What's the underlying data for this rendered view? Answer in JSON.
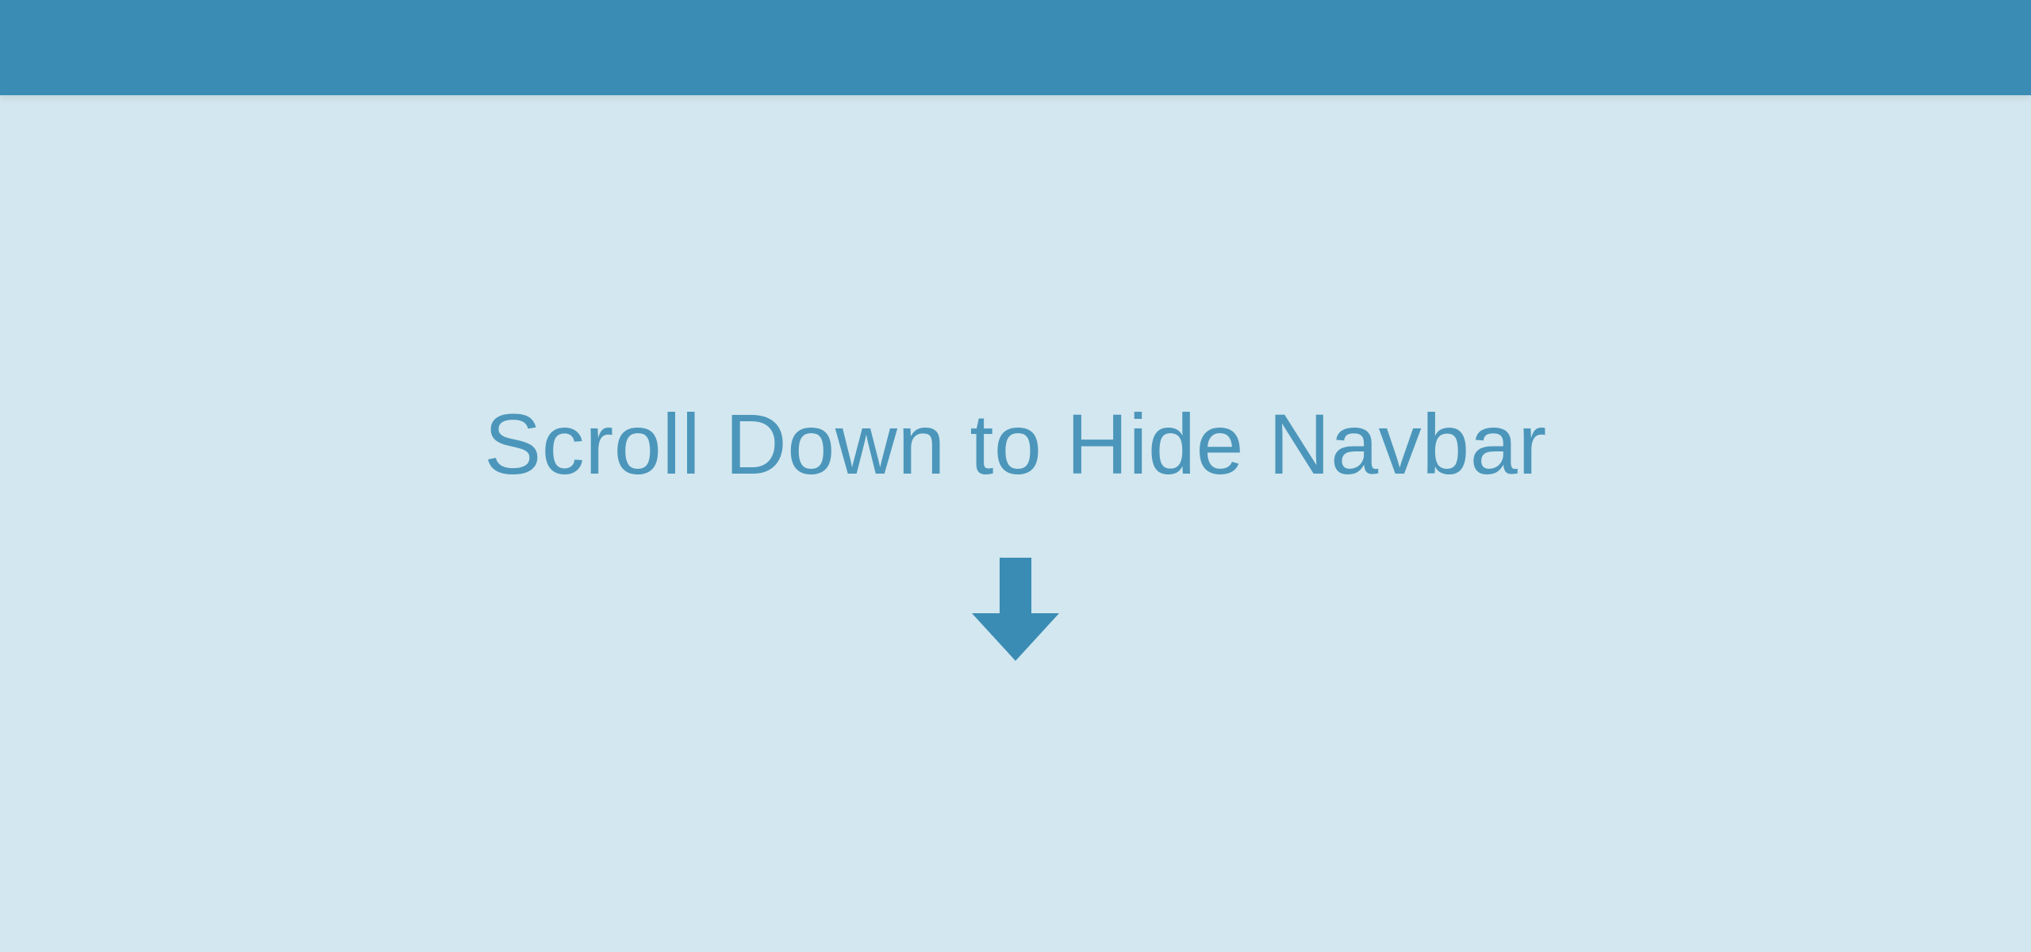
{
  "content": {
    "heading": "Scroll Down to Hide Navbar"
  }
}
